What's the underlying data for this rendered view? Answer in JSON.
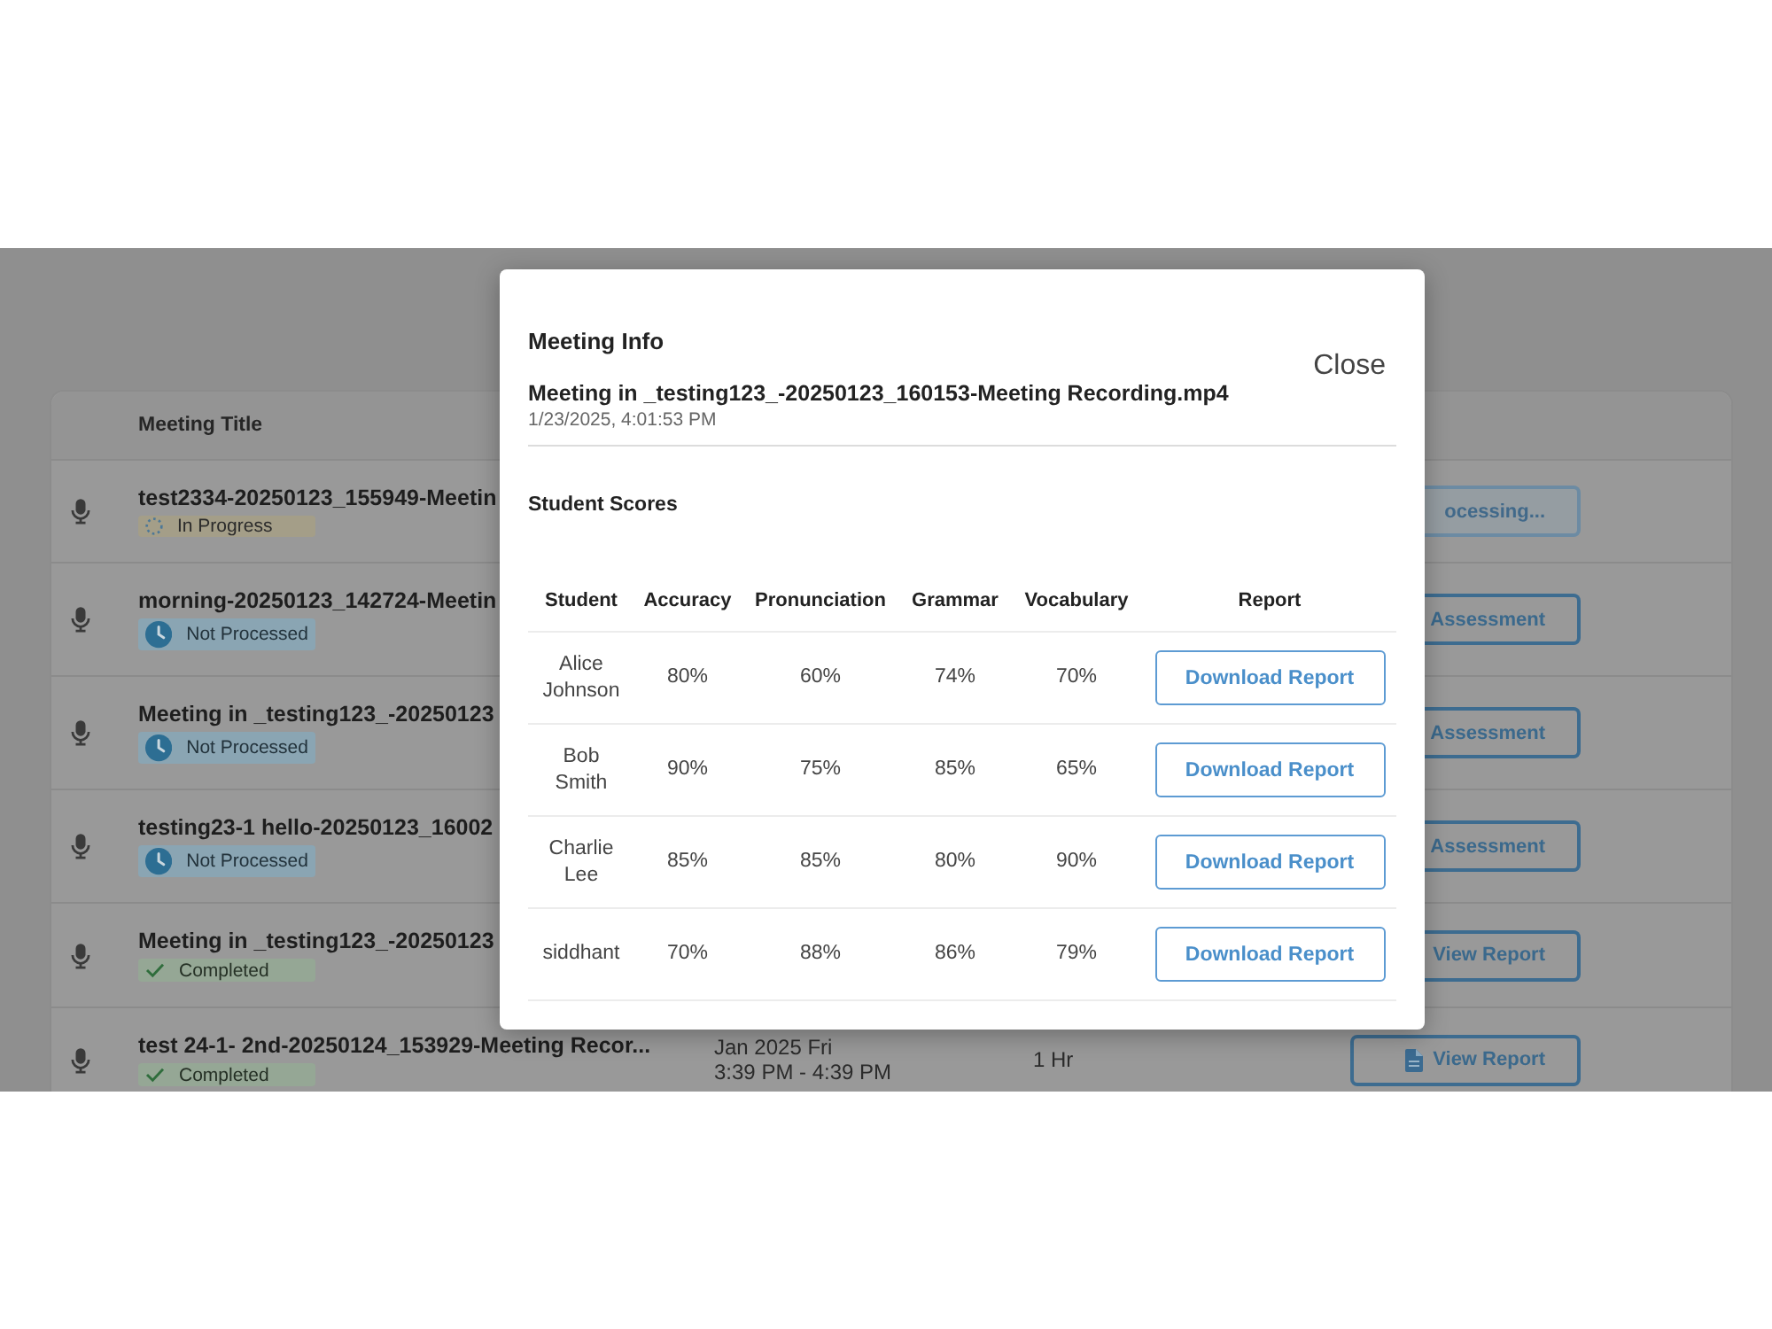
{
  "meetings_table": {
    "columns": [
      "Meeting Title"
    ],
    "rows": [
      {
        "title": "test2334-20250123_155949-Meetin",
        "status": {
          "kind": "in_progress",
          "label": "In Progress"
        },
        "action": {
          "label": "ocessing...",
          "disabled": true
        }
      },
      {
        "title": "morning-20250123_142724-Meetin",
        "status": {
          "kind": "not_processed",
          "label": "Not Processed"
        },
        "action": {
          "label": "Assessment",
          "disabled": false
        }
      },
      {
        "title": "Meeting in _testing123_-20250123",
        "status": {
          "kind": "not_processed",
          "label": "Not Processed"
        },
        "action": {
          "label": "Assessment",
          "disabled": false
        }
      },
      {
        "title": "testing23-1 hello-20250123_16002",
        "status": {
          "kind": "not_processed",
          "label": "Not Processed"
        },
        "action": {
          "label": "Assessment",
          "disabled": false
        }
      },
      {
        "title": "Meeting in _testing123_-20250123",
        "status": {
          "kind": "completed",
          "label": "Completed"
        },
        "action": {
          "label": "View Report",
          "disabled": false
        }
      },
      {
        "title": "test 24-1- 2nd-20250124_153929-Meeting Recor...",
        "status": {
          "kind": "completed",
          "label": "Completed"
        },
        "date": "Jan 2025 Fri",
        "time": "3:39 PM - 4:39 PM",
        "duration": "1 Hr",
        "action": {
          "label": "View Report",
          "disabled": false,
          "icon": true
        }
      }
    ]
  },
  "modal": {
    "title": "Meeting Info",
    "close_label": "Close",
    "meeting_name": "Meeting in _testing123_-20250123_160153-Meeting Recording.mp4",
    "timestamp": "1/23/2025, 4:01:53 PM",
    "section_title": "Student Scores",
    "table": {
      "columns": [
        "Student",
        "Accuracy",
        "Pronunciation",
        "Grammar",
        "Vocabulary",
        "Report"
      ],
      "rows": [
        {
          "student": "Alice Johnson",
          "accuracy": "80%",
          "pronunciation": "60%",
          "grammar": "74%",
          "vocabulary": "70%",
          "report_button": "Download Report"
        },
        {
          "student": "Bob Smith",
          "accuracy": "90%",
          "pronunciation": "75%",
          "grammar": "85%",
          "vocabulary": "65%",
          "report_button": "Download Report"
        },
        {
          "student": "Charlie Lee",
          "accuracy": "85%",
          "pronunciation": "85%",
          "grammar": "80%",
          "vocabulary": "90%",
          "report_button": "Download Report"
        },
        {
          "student": "siddhant",
          "accuracy": "70%",
          "pronunciation": "88%",
          "grammar": "86%",
          "vocabulary": "79%",
          "report_button": "Download Report"
        }
      ]
    }
  }
}
